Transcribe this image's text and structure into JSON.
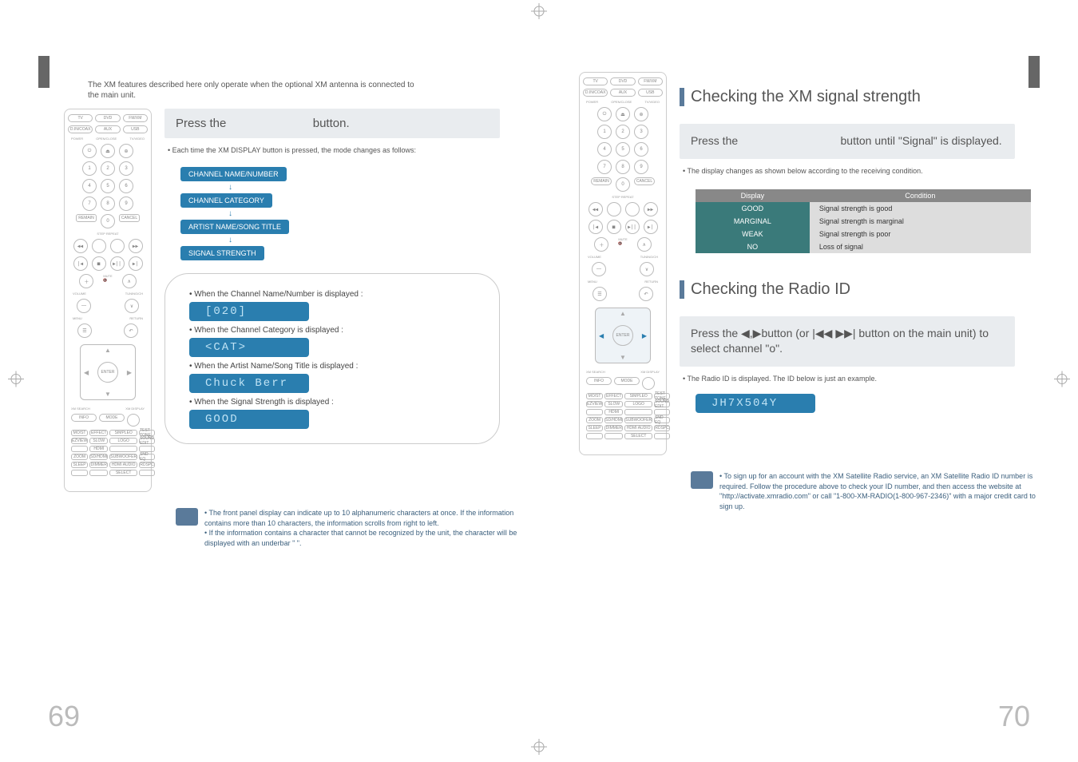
{
  "intro": "The XM features described here only operate when the optional XM antenna is connected to the main unit.",
  "left": {
    "step_head_pre": "Press the",
    "step_head_post": "button.",
    "mode_note": "Each time the XM DISPLAY button is pressed, the mode changes as follows:",
    "modes": [
      "CHANNEL NAME/NUMBER",
      "CHANNEL CATEGORY",
      "ARTIST NAME/SONG TITLE",
      "SIGNAL STRENGTH"
    ],
    "examples": [
      {
        "label": "When the Channel Name/Number is displayed :",
        "lcd": "[020]"
      },
      {
        "label": "When the Channel Category is displayed :",
        "lcd": "<CAT>"
      },
      {
        "label": "When the Artist Name/Song Title is displayed :",
        "lcd": "Chuck Berr"
      },
      {
        "label": "When the Signal Strength is displayed :",
        "lcd": "GOOD"
      }
    ],
    "note1": "The front panel display can indicate up to 10 alphanumeric characters at once. If the information contains more than 10 characters, the information scrolls from right to left.",
    "note2": "If the information contains a character that cannot be recognized by the unit, the character will be displayed with an underbar \"    \"."
  },
  "right": {
    "sec1_title": "Checking the XM signal strength",
    "sec1_step_pre": "Press the",
    "sec1_step_post": "button until \"Signal\" is displayed.",
    "sec1_note": "The display changes as shown below according to the receiving condition.",
    "table_head": [
      "Display",
      "Condition"
    ],
    "table_rows": [
      [
        "GOOD",
        "Signal strength is good"
      ],
      [
        "MARGINAL",
        "Signal strength is marginal"
      ],
      [
        "WEAK",
        "Signal strength is poor"
      ],
      [
        "NO",
        "Loss of signal"
      ]
    ],
    "sec2_title": "Checking the Radio ID",
    "sec2_step": "Press the ◀,▶button (or |◀◀ ▶▶| button on the main unit) to select channel \"o\".",
    "sec2_note": "The Radio ID is displayed. The ID below is just an example.",
    "sec2_lcd": "JH7X504Y",
    "note": "To sign up for an account with the XM Satellite Radio service, an XM Satellite Radio ID number is required. Follow the procedure above to check your ID number, and then access the website at \"http://activate.xmradio.com\" or call \"1-800-XM-RADIO(1-800-967-2346)\" with a major credit card to sign up."
  },
  "page_numbers": {
    "left": "69",
    "right": "70"
  },
  "remote": {
    "top_row": [
      "TV",
      "DVD",
      "FM/XM"
    ],
    "top_row2": [
      "D.IN/COAX",
      "AUX",
      "USB"
    ],
    "labels": [
      "POWER",
      "OPEN/CLOSE",
      "TV/VIDEO"
    ],
    "numpad": [
      "1",
      "2",
      "3",
      "4",
      "5",
      "6",
      "7",
      "8",
      "9"
    ],
    "mid": [
      "REMAIN",
      "0",
      "CANCEL"
    ],
    "step_repeat": "STEP   REPEAT",
    "transport": [
      "◀◀",
      "■",
      "▶||",
      "▶▶"
    ],
    "transport_top": [
      "◀◀",
      " ",
      " ",
      "▶▶"
    ],
    "vol": "+",
    "mute": "MUTE",
    "tuning": "TUNING/CH",
    "menu": "MENU",
    "return": "RETURN",
    "enter": "ENTER",
    "xm_search": "XM SEARCH",
    "xm_display": "XM DISPLAY",
    "info": "INFO",
    "mode": "MODE",
    "bottom_grid": [
      "MO/ST",
      "EFFECT",
      "SIMPLEO",
      "TEST TONE",
      "EZVIEW",
      "SLOW",
      "LOGO",
      "SOUND EDIT",
      "",
      "HDMI",
      "",
      "",
      "ZOOM",
      "SD/HDMI",
      "SUBWOOFER",
      "SND EQ",
      "SLEEP",
      "DIMMER",
      "HDMI AUDIO",
      "RDSPC",
      "",
      "",
      "SELECT",
      ""
    ]
  }
}
